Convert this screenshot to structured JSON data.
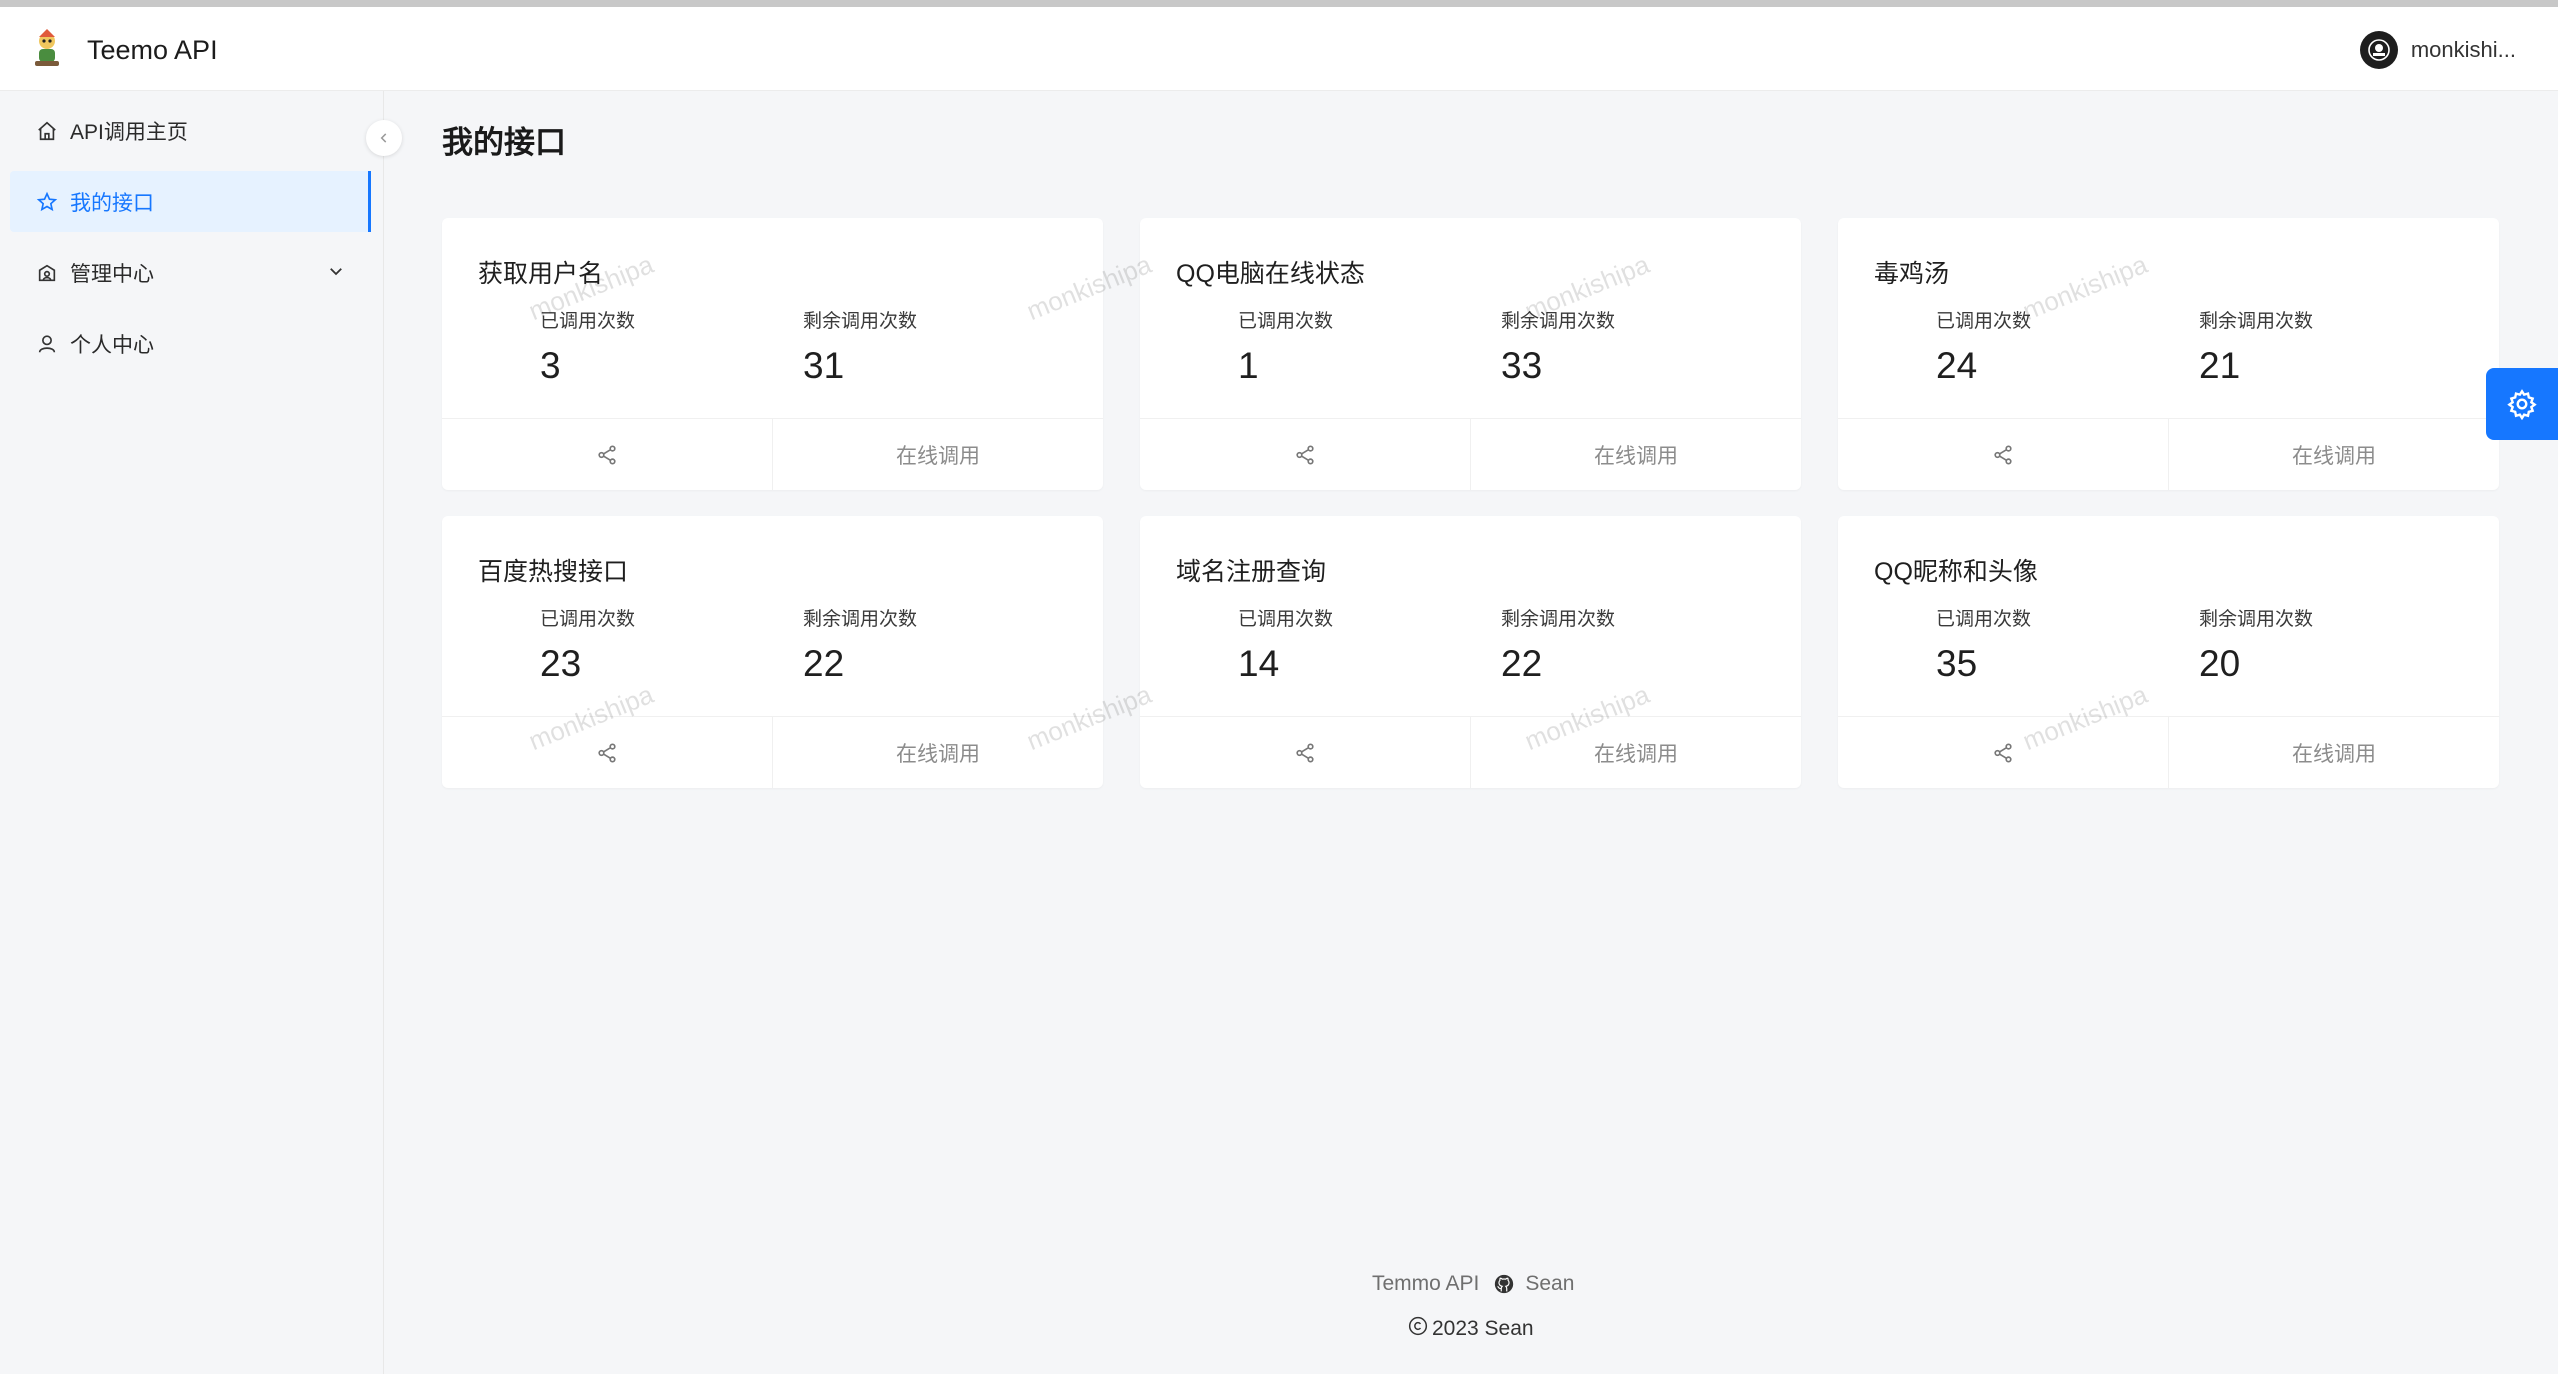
{
  "header": {
    "app_title": "Teemo API",
    "username": "monkishi..."
  },
  "sidebar": {
    "items": [
      {
        "label": "API调用主页",
        "icon": "home-icon"
      },
      {
        "label": "我的接口",
        "icon": "star-icon",
        "active": true
      },
      {
        "label": "管理中心",
        "icon": "admin-icon",
        "has_submenu": true
      },
      {
        "label": "个人中心",
        "icon": "user-icon"
      }
    ]
  },
  "main": {
    "page_title": "我的接口",
    "stat_labels": {
      "used": "已调用次数",
      "remaining": "剩余调用次数"
    },
    "action_label": "在线调用",
    "cards": [
      {
        "title": "获取用户名",
        "used": "3",
        "remaining": "31"
      },
      {
        "title": "QQ电脑在线状态",
        "used": "1",
        "remaining": "33"
      },
      {
        "title": "毒鸡汤",
        "used": "24",
        "remaining": "21"
      },
      {
        "title": "百度热搜接口",
        "used": "23",
        "remaining": "22"
      },
      {
        "title": "域名注册查询",
        "used": "14",
        "remaining": "22"
      },
      {
        "title": "QQ昵称和头像",
        "used": "35",
        "remaining": "20"
      }
    ]
  },
  "watermark": "monkishipa",
  "footer": {
    "brand": "Temmo API",
    "author": "Sean",
    "copyright": "2023 Sean"
  },
  "colors": {
    "accent": "#1677ff",
    "active_bg": "#e6f2ff",
    "page_bg": "#f5f6f8"
  }
}
